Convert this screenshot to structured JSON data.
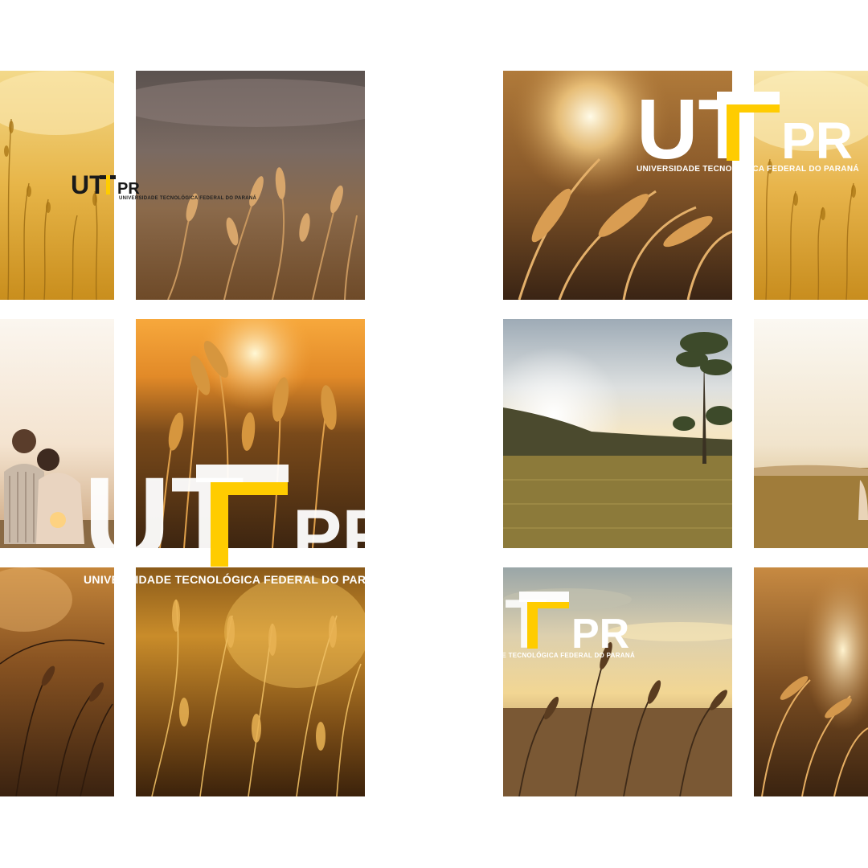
{
  "brand": {
    "letters_left": "UT",
    "letters_right": "PR",
    "tagline": "UNIVERSIDADE TECNOLÓGICA FEDERAL DO PARANÁ",
    "accent_yellow": "#FFCC00",
    "dark": "#1a1a1a",
    "white": "#FFFFFF"
  },
  "tiles": [
    {
      "id": "a1",
      "subject": "golden-grass-haze"
    },
    {
      "id": "b1",
      "subject": "wheat-under-cloudy-sky"
    },
    {
      "id": "a2",
      "subject": "couple-sitting-at-sunset"
    },
    {
      "id": "b2",
      "subject": "wheat-ears-at-sunset"
    },
    {
      "id": "a3",
      "subject": "grass-silhouette-sunset"
    },
    {
      "id": "b3",
      "subject": "backlit-grass-field"
    },
    {
      "id": "c1",
      "subject": "grass-with-sun-flare"
    },
    {
      "id": "d1",
      "subject": "golden-grass-haze"
    },
    {
      "id": "c2",
      "subject": "field-with-tree-and-sun"
    },
    {
      "id": "d2",
      "subject": "hazy-field-horizon"
    },
    {
      "id": "c3",
      "subject": "reeds-against-evening-sky"
    },
    {
      "id": "d3",
      "subject": "grass-with-sun-flare"
    }
  ]
}
